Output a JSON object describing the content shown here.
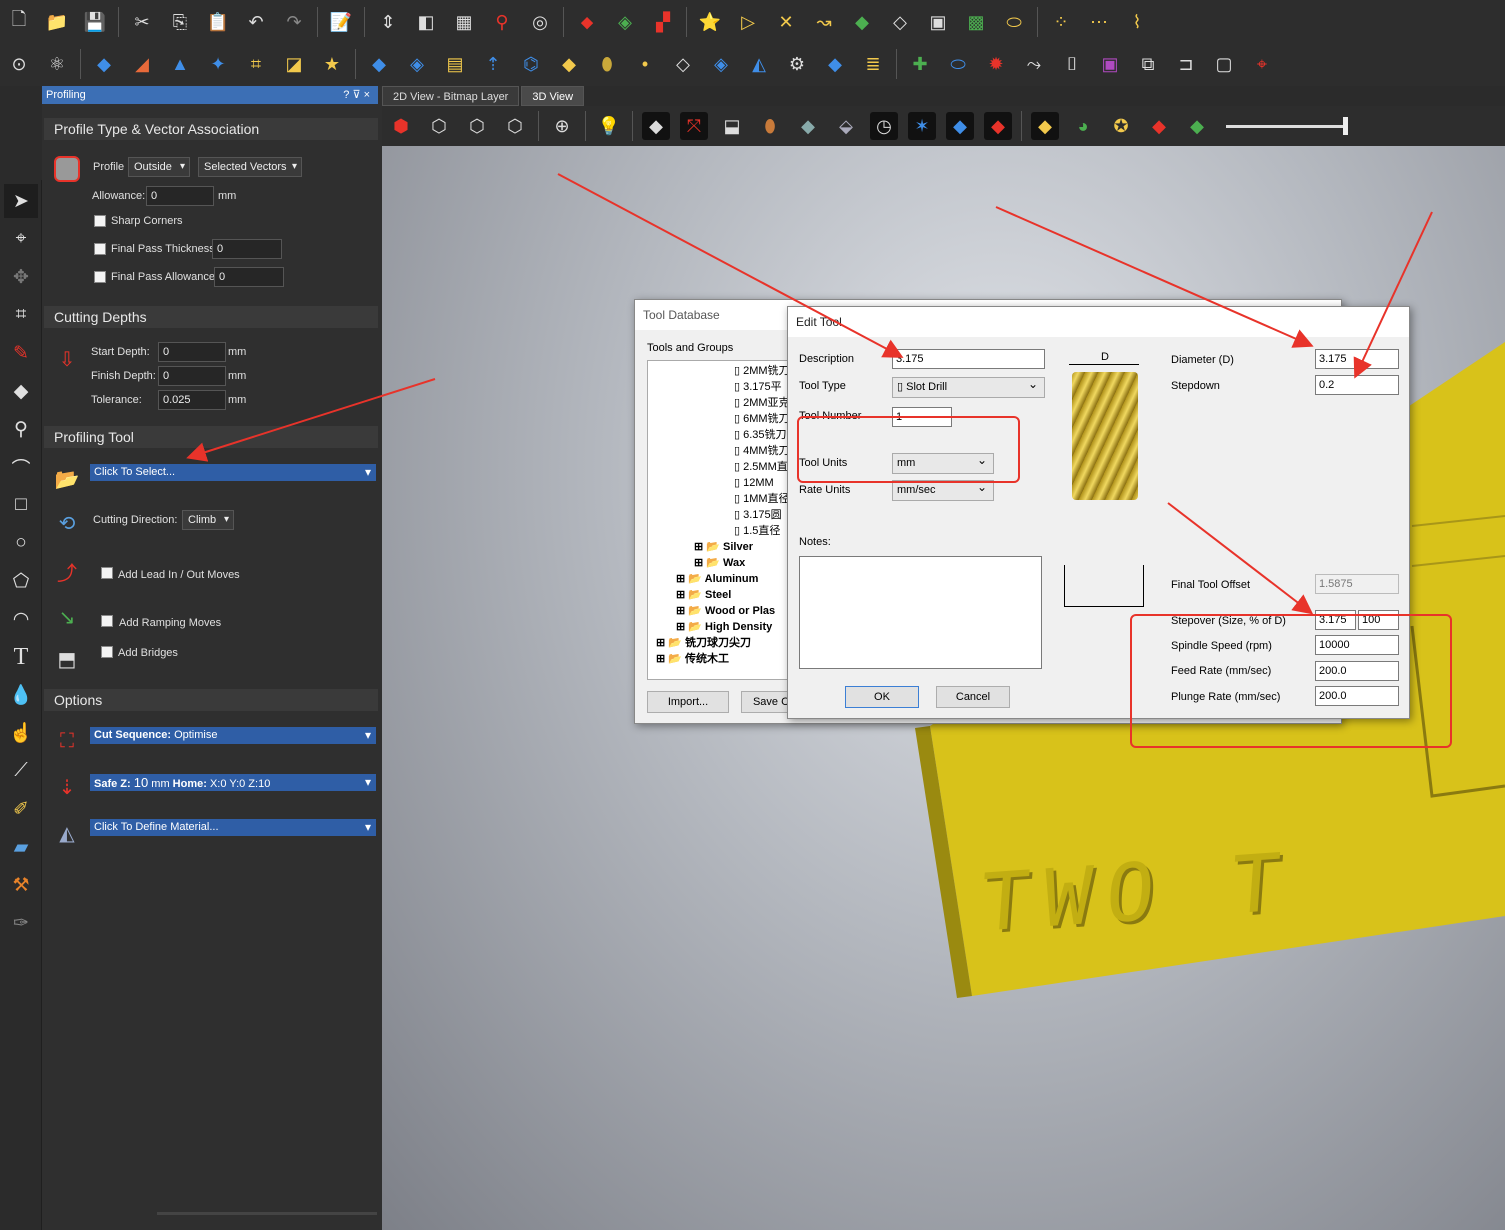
{
  "colors": {
    "accent": "#3c6fb5",
    "annotation": "#e8332a",
    "model": "#d8c21a"
  },
  "toolbar1_icons": [
    "new-file-icon",
    "open-folder-icon",
    "save-icon",
    "cut-icon",
    "copy-icon",
    "paste-icon",
    "undo-icon",
    "redo-icon",
    "notes-icon",
    "measure-icon",
    "flip-icon",
    "grid-icon",
    "pin-icon",
    "toolpath-icon",
    "paint-icon",
    "layer-icon",
    "color-icon",
    "import-icon",
    "vector-icon",
    "node-icon",
    "curve-icon",
    "component-icon",
    "stack-icon",
    "offset-icon",
    "pattern-icon",
    "plate-icon",
    "nodes-icon",
    "dots-icon",
    "path-icon"
  ],
  "toolbar2_icons": [
    "zoom-icon",
    "atom-icon",
    "diamond-icon",
    "sweep-icon",
    "extrude-icon",
    "relief-icon",
    "weave-icon",
    "texture-icon",
    "star-folder-icon",
    "plane-icon",
    "split-icon",
    "stripe-icon",
    "raise-icon",
    "mesh-icon",
    "sand-icon",
    "dome-icon",
    "dot-icon",
    "fade-icon",
    "pile-icon",
    "wedge-icon",
    "cone-icon",
    "slab-icon",
    "layers-icon",
    "add-icon",
    "bowl-icon",
    "gear-icon",
    "arrow-curve-icon",
    "bracket-icon",
    "square-icon",
    "clip-icon",
    "hook-icon",
    "rounded-rect-icon",
    "target-icon"
  ],
  "panel": {
    "title": "Profiling",
    "title_buttons": "? ⊽ ×",
    "section_profile": "Profile Type & Vector Association",
    "profile_label": "Profile",
    "profile_type": "Outside",
    "vector_select": "Selected Vectors",
    "allowance_label": "Allowance:",
    "allowance_value": "0",
    "allowance_unit": "mm",
    "sharp_corners": "Sharp Corners",
    "final_pass_thickness": "Final Pass Thickness",
    "final_pass_thickness_value": "0",
    "final_pass_allowance": "Final Pass Allowance",
    "final_pass_allowance_value": "0",
    "section_depths": "Cutting Depths",
    "start_depth_label": "Start Depth:",
    "start_depth": "0",
    "finish_depth_label": "Finish Depth:",
    "finish_depth": "0",
    "tolerance_label": "Tolerance:",
    "tolerance": "0.025",
    "unit_mm": "mm",
    "section_tool": "Profiling Tool",
    "tool_select": "Click To Select...",
    "cutting_direction_label": "Cutting Direction:",
    "cutting_direction": "Climb",
    "lead_in_out": "Add Lead In / Out Moves",
    "ramping": "Add Ramping Moves",
    "bridges": "Add Bridges",
    "section_options": "Options",
    "cut_sequence_bold": "Cut Sequence:",
    "cut_sequence_value": "Optimise",
    "safez_bold": "Safe Z:",
    "safez_value": "10",
    "safez_unit": "mm",
    "home_bold": "Home:",
    "home_value": "X:0 Y:0 Z:10",
    "material": "Click To Define Material..."
  },
  "tabs": {
    "tab1": "2D View - Bitmap Layer",
    "tab2": "3D View"
  },
  "tool_database": {
    "title": "Tool Database",
    "tree_label": "Tools and Groups",
    "items": [
      "2MM铣刀",
      "3.175平",
      "2MM亚克",
      "6MM铣刀",
      "6.35铣刀",
      "4MM铣刀",
      "2.5MM直",
      "12MM",
      "1MM直径",
      "3.175圆",
      "1.5直径"
    ],
    "groups": [
      "Silver",
      "Wax",
      "Aluminum",
      "Steel",
      "Wood or Plas",
      "High Density",
      "铣刀球刀尖刀",
      "传统木工"
    ],
    "import_button": "Import...",
    "save_button": "Save C"
  },
  "edit_tool": {
    "title": "Edit Tool",
    "description_label": "Description",
    "description": "3.175",
    "tool_type_label": "Tool Type",
    "tool_type": "Slot Drill",
    "tool_number_label": "Tool Number",
    "tool_number": "1",
    "tool_units_label": "Tool Units",
    "tool_units": "mm",
    "rate_units_label": "Rate Units",
    "rate_units": "mm/sec",
    "notes_label": "Notes:",
    "d_label": "D",
    "diameter_label": "Diameter (D)",
    "diameter": "3.175",
    "stepdown_label": "Stepdown",
    "stepdown": "0.2",
    "final_offset_label": "Final Tool Offset",
    "final_offset": "1.5875",
    "stepover_label": "Stepover (Size, % of D)",
    "stepover_size": "3.175",
    "stepover_pct": "100",
    "spindle_label": "Spindle Speed (rpm)",
    "spindle": "10000",
    "feed_label": "Feed Rate (mm/sec)",
    "feed": "200.0",
    "plunge_label": "Plunge Rate (mm/sec)",
    "plunge": "200.0",
    "ok": "OK",
    "cancel": "Cancel"
  },
  "model_text": "TWO T"
}
